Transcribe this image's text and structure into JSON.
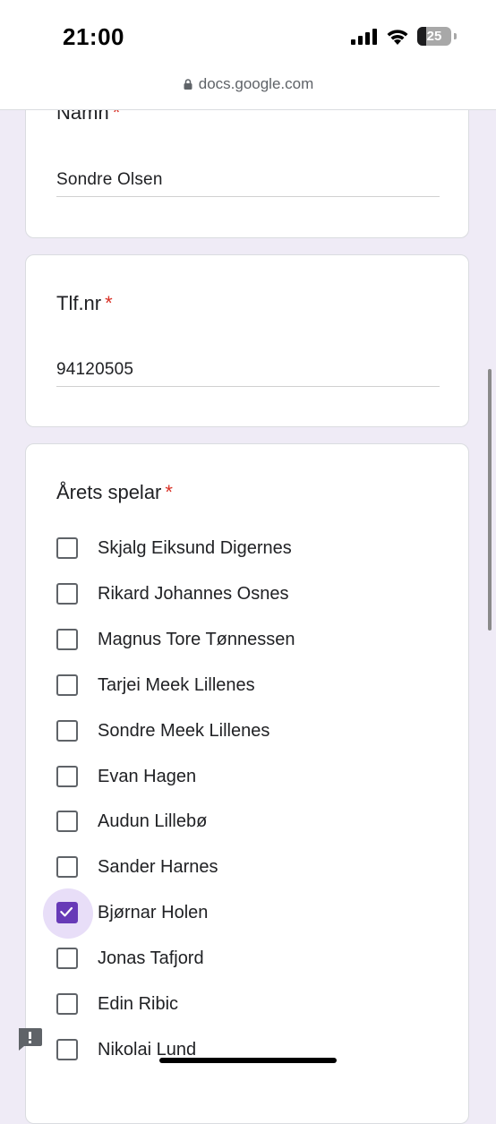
{
  "status_bar": {
    "time": "21:00",
    "battery_level": "25",
    "icons": [
      "signal-icon",
      "wifi-icon",
      "battery-icon"
    ]
  },
  "browser": {
    "url": "docs.google.com",
    "icon": "lock-icon"
  },
  "form": {
    "name_question": {
      "title": "Namn",
      "required_mark": "*",
      "value": "Sondre Olsen"
    },
    "phone_question": {
      "title": "Tlf.nr",
      "required_mark": "*",
      "value": "94120505"
    },
    "player_question": {
      "title": "Årets spelar",
      "required_mark": "*",
      "options": [
        {
          "label": "Skjalg Eiksund Digernes",
          "checked": false
        },
        {
          "label": "Rikard Johannes Osnes",
          "checked": false
        },
        {
          "label": "Magnus Tore Tønnessen",
          "checked": false
        },
        {
          "label": "Tarjei Meek Lillenes",
          "checked": false
        },
        {
          "label": "Sondre Meek Lillenes",
          "checked": false
        },
        {
          "label": "Evan Hagen",
          "checked": false
        },
        {
          "label": "Audun Lillebø",
          "checked": false
        },
        {
          "label": "Sander Harnes",
          "checked": false
        },
        {
          "label": "Bjørnar Holen",
          "checked": true
        },
        {
          "label": "Jonas Tafjord",
          "checked": false
        },
        {
          "label": "Edin Ribic",
          "checked": false
        },
        {
          "label": "Nikolai Lund",
          "checked": false
        }
      ]
    }
  },
  "colors": {
    "accent": "#673ab7",
    "required": "#d93025",
    "page_background": "#efebf6"
  }
}
